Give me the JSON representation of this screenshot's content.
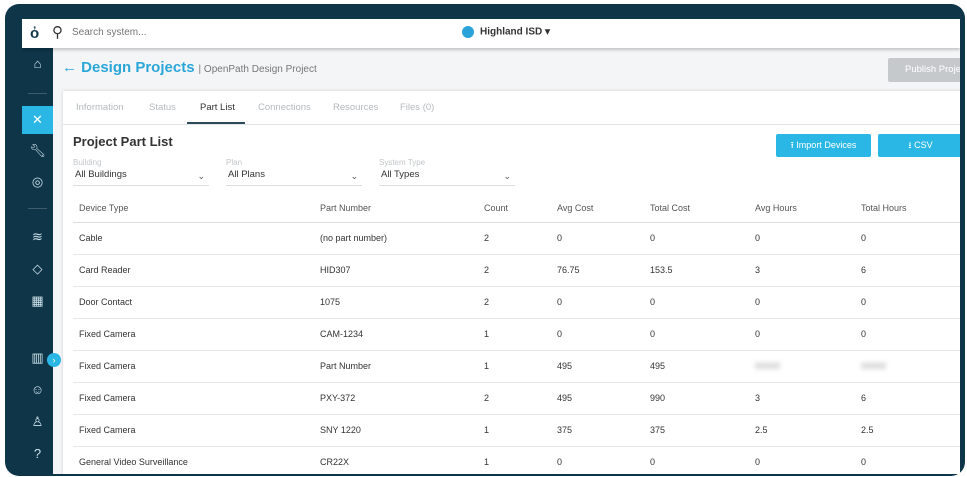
{
  "topbar": {
    "search_placeholder": "Search system...",
    "org": "Highland ISD ▾"
  },
  "header": {
    "title": "← Design Projects",
    "subtitle": "| OpenPath Design Project",
    "publish": "Publish Project"
  },
  "tabs": [
    "Information",
    "Status",
    "Part List",
    "Connections",
    "Resources",
    "Files (0)"
  ],
  "card": {
    "title": "Project Part List",
    "import": "⭱ Import Devices",
    "csv": "⭳ CSV"
  },
  "filters": [
    {
      "label": "Building",
      "value": "All Buildings"
    },
    {
      "label": "Plan",
      "value": "All Plans"
    },
    {
      "label": "System Type",
      "value": "All Types"
    }
  ],
  "columns": [
    "Device Type",
    "Part Number",
    "Count",
    "Avg Cost",
    "Total Cost",
    "Avg Hours",
    "Total Hours"
  ],
  "rows": [
    [
      "Cable",
      "(no part number)",
      "2",
      "0",
      "0",
      "0",
      "0"
    ],
    [
      "Card Reader",
      "HID307",
      "2",
      "76.75",
      "153.5",
      "3",
      "6"
    ],
    [
      "Door Contact",
      "1075",
      "2",
      "0",
      "0",
      "0",
      "0"
    ],
    [
      "Fixed Camera",
      "CAM-1234",
      "1",
      "0",
      "0",
      "0",
      "0"
    ],
    [
      "Fixed Camera",
      "Part Number",
      "1",
      "495",
      "495",
      "00000",
      "00000"
    ],
    [
      "Fixed Camera",
      "PXY-372",
      "2",
      "495",
      "990",
      "3",
      "6"
    ],
    [
      "Fixed Camera",
      "SNY 1220",
      "1",
      "375",
      "375",
      "2.5",
      "2.5"
    ],
    [
      "General Video Surveillance",
      "CR22X",
      "1",
      "0",
      "0",
      "0",
      "0"
    ]
  ]
}
